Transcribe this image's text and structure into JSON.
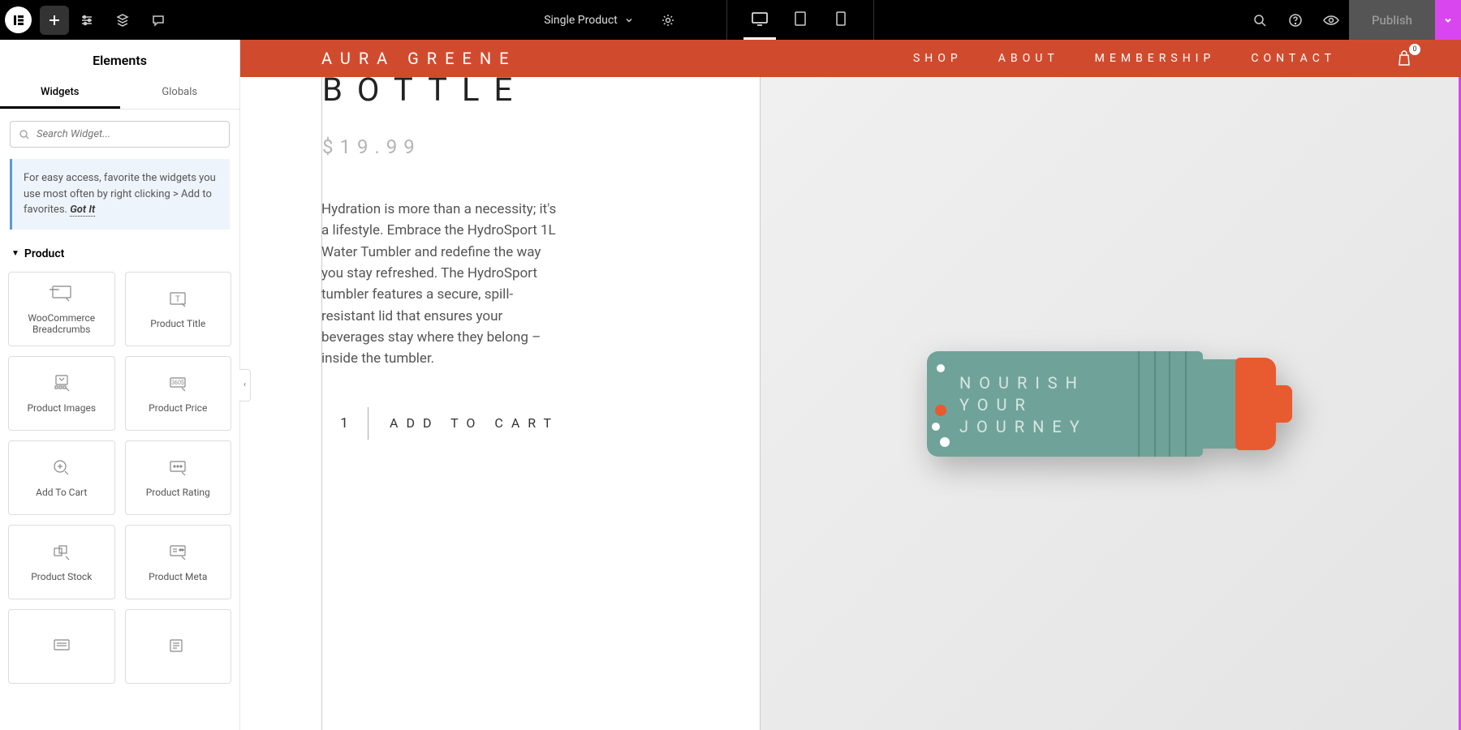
{
  "topbar": {
    "doc_title": "Single Product",
    "publish_label": "Publish"
  },
  "sidebar": {
    "title": "Elements",
    "tabs": {
      "widgets": "Widgets",
      "globals": "Globals"
    },
    "search_placeholder": "Search Widget...",
    "tip_text": "For easy access, favorite the widgets you use most often by right clicking > Add to favorites.",
    "tip_action": "Got It",
    "section": "Product",
    "widgets": [
      "WooCommerce Breadcrumbs",
      "Product Title",
      "Product Images",
      "Product Price",
      "Add To Cart",
      "Product Rating",
      "Product Stock",
      "Product Meta"
    ]
  },
  "site": {
    "brand": "AURA GREENE",
    "nav": [
      "SHOP",
      "ABOUT",
      "MEMBERSHIP",
      "CONTACT"
    ],
    "cart_count": "0"
  },
  "product": {
    "title": "BOTTLE",
    "price": "$19.99",
    "description": "Hydration is more than a necessity; it's a lifestyle. Embrace the HydroSport 1L Water Tumbler and redefine the way you stay refreshed. The HydroSport tumbler features a secure, spill-resistant lid that ensures your beverages stay where they belong – inside the tumbler.",
    "qty": "1",
    "add_label": "ADD TO CART",
    "bottle_line1": "NOURISH",
    "bottle_line2": "YOUR",
    "bottle_line3": "JOURNEY"
  }
}
